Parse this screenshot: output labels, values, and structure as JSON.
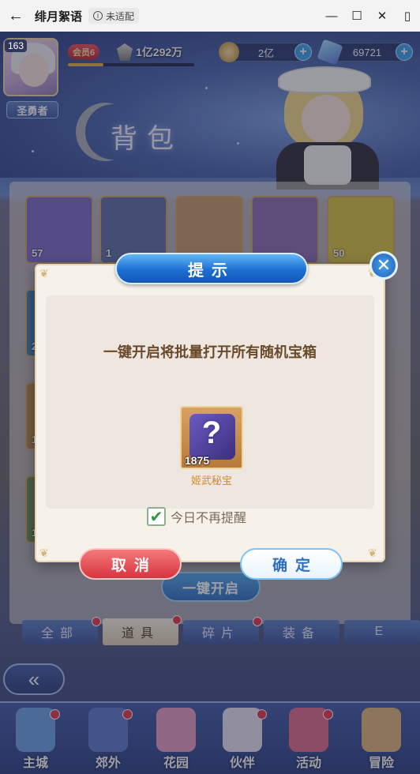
{
  "window": {
    "title": "绯月絮语",
    "badge": "未适配",
    "back_icon": "arrow-left-icon",
    "minimize_icon": "minimize-icon",
    "maximize_icon": "maximize-icon",
    "close_icon": "close-icon",
    "sidebar_icon": "sidebar-icon"
  },
  "player": {
    "level": "163",
    "title": "圣勇者",
    "vip": "会员6",
    "power": "1亿292万",
    "power_progress": 0.28
  },
  "resources": {
    "gold": "2亿",
    "gems": "69721"
  },
  "page": {
    "title": "背包"
  },
  "grid": [
    {
      "count": "57",
      "color": "#7a6ac8"
    },
    {
      "count": "1",
      "color": "#5c6ea8"
    },
    {
      "count": "",
      "color": "#c79a6a"
    },
    {
      "count": "",
      "color": "#8a6ab0"
    },
    {
      "count": "50",
      "color": "#d8c43c"
    },
    {
      "count": "2",
      "color": "#3f7db0"
    },
    {
      "count": "1",
      "color": "#b0854a"
    },
    {
      "count": "1",
      "color": "#6a8a50"
    }
  ],
  "open_all_button": "一键开启",
  "tabs": [
    {
      "label": "全部",
      "dot": true,
      "active": false
    },
    {
      "label": "道具",
      "dot": true,
      "active": true
    },
    {
      "label": "碎片",
      "dot": true,
      "active": false
    },
    {
      "label": "装备",
      "dot": false,
      "active": false
    },
    {
      "label": "E",
      "dot": false,
      "active": false
    }
  ],
  "bottom_nav": [
    {
      "label": "主城",
      "icon": "castle-icon",
      "dot": true,
      "color": "#6aa0e6"
    },
    {
      "label": "郊外",
      "icon": "compass-icon",
      "dot": true,
      "color": "#5e7bd0"
    },
    {
      "label": "花园",
      "icon": "heart-garden-icon",
      "dot": false,
      "color": "#e89bc7"
    },
    {
      "label": "伙伴",
      "icon": "partner-icon",
      "dot": true,
      "color": "#e7e3f5"
    },
    {
      "label": "活动",
      "icon": "gift-icon",
      "dot": true,
      "color": "#e06a8a"
    },
    {
      "label": "冒险",
      "icon": "adventure-icon",
      "dot": false,
      "color": "#e0b57a"
    }
  ],
  "dialog": {
    "title": "提示",
    "message": "一键开启将批量打开所有随机宝箱",
    "reward_count": "1875",
    "reward_name": "姬武秘宝",
    "checkbox_label": "今日不再提醒",
    "checkbox_checked": true,
    "cancel": "取消",
    "confirm": "确定"
  }
}
